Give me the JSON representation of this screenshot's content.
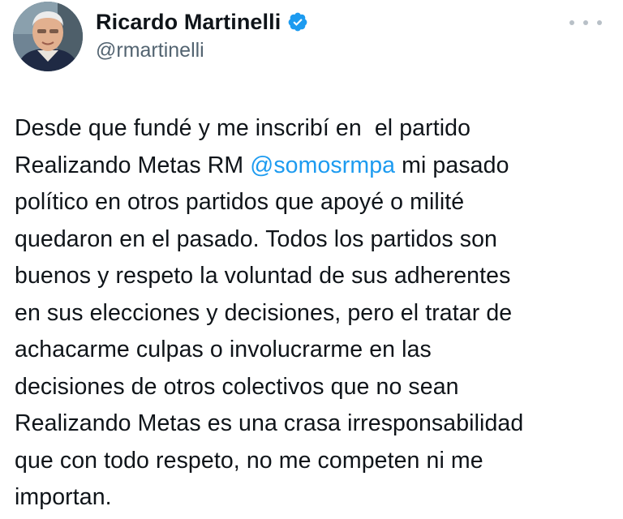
{
  "colors": {
    "mention": "#1d9bf0",
    "verified": "#1d9bf0",
    "text": "#0f1419",
    "secondary": "#536471"
  },
  "author": {
    "display_name": "Ricardo Martinelli",
    "handle": "@rmartinelli",
    "verified_icon": "verified-badge-icon",
    "avatar_icon": "profile-photo"
  },
  "menu": {
    "icon": "more-options-icon"
  },
  "tweet": {
    "text_before_mention": "Desde que fundé y me inscribí en  el partido\nRealizando Metas RM ",
    "mention": "@somosrmpa",
    "text_after_mention": " mi pasado\npolítico en otros partidos que apoyé o milité\nquedaron en el pasado. Todos los partidos son\nbuenos y respeto la voluntad de sus adherentes\nen sus elecciones y decisiones, pero el tratar de\nachacarme culpas o involucrarme en las\ndecisiones de otros colectivos que no sean\nRealizando Metas es una crasa irresponsabilidad\nque con todo respeto, no me competen ni me\nimportan."
  }
}
